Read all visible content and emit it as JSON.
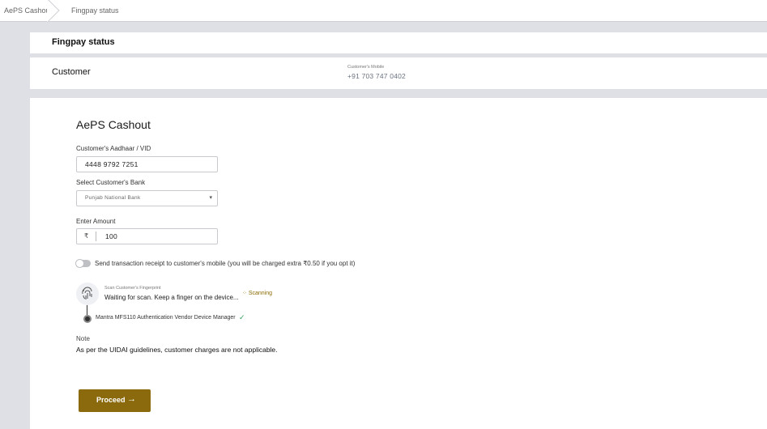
{
  "breadcrumb": {
    "items": [
      "AePS Cashout",
      "Fingpay status"
    ]
  },
  "status_panel": {
    "title": "Fingpay status"
  },
  "customer_panel": {
    "title": "Customer",
    "mobile_label": "Customer's Mobile",
    "mobile_value": "+91 703 747 0402"
  },
  "form": {
    "title": "AePS Cashout",
    "aadhaar": {
      "label": "Customer's Aadhaar / VID",
      "value": "4448 9792 7251"
    },
    "bank": {
      "label": "Select Customer's Bank",
      "value": "Punjab National Bank"
    },
    "amount": {
      "label": "Enter Amount",
      "currency": "₹",
      "value": "100"
    },
    "receipt_toggle": {
      "label": "Send transaction receipt to customer's mobile (you will be charged extra ₹0.50 if you opt it)",
      "on": false
    },
    "fingerprint": {
      "label": "Scan Customer's Fingerprint",
      "status_text": "Waiting for scan. Keep a finger on the device...",
      "state": "Scanning",
      "device": "Mantra MFS110 Authentication Vendor Device Manager"
    },
    "note": {
      "label": "Note",
      "text": "As per the UIDAI guidelines, customer charges are not applicable."
    },
    "proceed_label": "Proceed"
  },
  "colors": {
    "accent": "#8a6a0c",
    "success": "#2e9e5b",
    "background": "#dfe0e6"
  },
  "icons": {
    "fingerprint": "fingerprint-icon",
    "scanning": "spinner-icon",
    "check": "check-icon",
    "arrow": "arrow-right-icon",
    "chevron": "chevron-down-icon"
  }
}
